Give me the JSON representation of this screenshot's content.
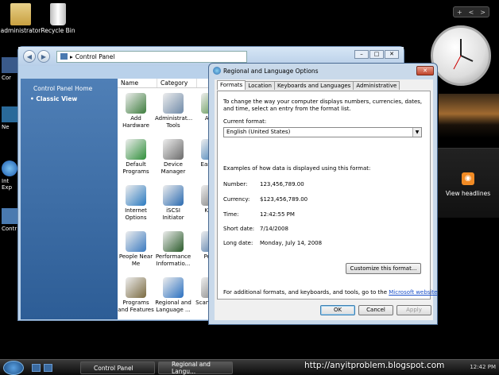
{
  "desktop": {
    "icons": [
      {
        "label": "administrator"
      },
      {
        "label": "Recycle Bin"
      }
    ],
    "edge_labels": [
      "Cor",
      "Ne",
      "Int\nExp",
      "Contr"
    ]
  },
  "sidebar": {
    "controls": [
      "+",
      "<",
      ">"
    ],
    "feed_label": "View headlines"
  },
  "control_panel": {
    "address": "Control Panel",
    "home_link": "Control Panel Home",
    "classic_view": "Classic View",
    "columns": [
      "Name",
      "Category"
    ],
    "items": [
      {
        "label": "Add Hardware",
        "icon": "add-hardware-icon",
        "color": "#3d7d3d"
      },
      {
        "label": "Administrat... Tools",
        "icon": "admin-tools-icon",
        "color": "#6f8aa8"
      },
      {
        "label": "Auto",
        "icon": "autoplay-icon",
        "color": "#4a8a3a"
      },
      {
        "label": "Default Programs",
        "icon": "default-programs-icon",
        "color": "#2f8f3a"
      },
      {
        "label": "Device Manager",
        "icon": "device-manager-icon",
        "color": "#6a6a6a"
      },
      {
        "label": "Eas Acc",
        "icon": "ease-of-access-icon",
        "color": "#2a70b0"
      },
      {
        "label": "Internet Options",
        "icon": "internet-options-icon",
        "color": "#2a7ac0"
      },
      {
        "label": "iSCSI Initiator",
        "icon": "iscsi-icon",
        "color": "#2a6ab0"
      },
      {
        "label": "Keyb",
        "icon": "keyboard-icon",
        "color": "#707070"
      },
      {
        "label": "People Near Me",
        "icon": "people-icon",
        "color": "#3a7ac0"
      },
      {
        "label": "Performance Informatio...",
        "icon": "performance-icon",
        "color": "#2a5a2a"
      },
      {
        "label": "Perso",
        "icon": "personalization-icon",
        "color": "#3a6aa0"
      },
      {
        "label": "Programs and Features",
        "icon": "programs-icon",
        "color": "#7a6a40"
      },
      {
        "label": "Regional and Language ...",
        "icon": "regional-icon",
        "color": "#2a70c0"
      },
      {
        "label": "Scann Cam",
        "icon": "scanner-icon",
        "color": "#7a7a7a"
      }
    ]
  },
  "dialog": {
    "title": "Regional and Language Options",
    "tabs": [
      "Formats",
      "Location",
      "Keyboards and Languages",
      "Administrative"
    ],
    "intro": "To change the way your computer displays numbers, currencies, dates, and time, select an entry from the format list.",
    "current_format_label": "Current format:",
    "current_format_value": "English (United States)",
    "examples_label": "Examples of how data is displayed using this format:",
    "examples": [
      {
        "label": "Number:",
        "value": "123,456,789.00"
      },
      {
        "label": "Currency:",
        "value": "$123,456,789.00"
      },
      {
        "label": "Time:",
        "value": "12:42:55 PM"
      },
      {
        "label": "Short date:",
        "value": "7/14/2008"
      },
      {
        "label": "Long date:",
        "value": "Monday, July 14, 2008"
      }
    ],
    "customize_button": "Customize this format...",
    "additional_text": "For additional formats, and keyboards, and tools, go to the",
    "additional_link": "Microsoft website",
    "additional_end": ".",
    "ok": "OK",
    "cancel": "Cancel",
    "apply": "Apply"
  },
  "taskbar": {
    "buttons": [
      "Control Panel",
      "Regional and Langu..."
    ],
    "tray_time": "12:42 PM"
  },
  "watermark": "http://anyitproblem.blogspot.com"
}
